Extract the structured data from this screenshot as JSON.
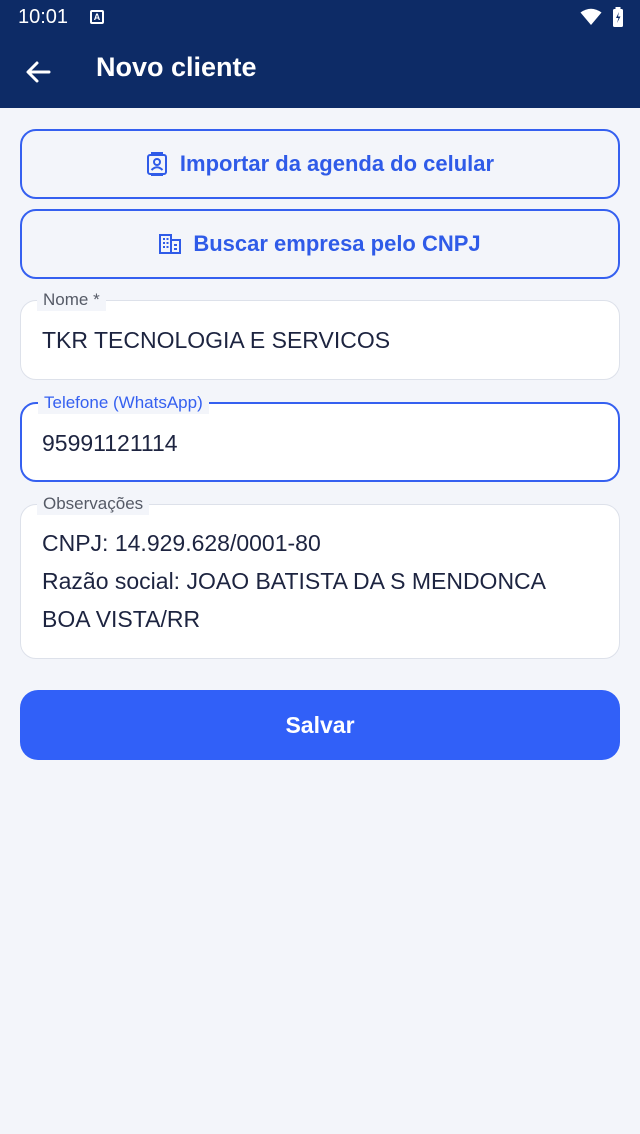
{
  "status_bar": {
    "time": "10:01",
    "notification_glyph": "A"
  },
  "appbar": {
    "title": "Novo cliente",
    "background_color": "#0d2b66"
  },
  "actions": {
    "import_contacts_label": "Importar da agenda do celular",
    "import_contacts_icon": "contact-card-icon",
    "search_cnpj_label": "Buscar empresa pelo CNPJ",
    "search_cnpj_icon": "building-icon"
  },
  "form": {
    "nome": {
      "label": "Nome *",
      "value": "TKR TECNOLOGIA E SERVICOS"
    },
    "telefone": {
      "label": "Telefone (WhatsApp)",
      "value": "95991121114"
    },
    "observacoes": {
      "label": "Observações",
      "lines": [
        "CNPJ: 14.929.628/0001-80",
        "Razão social: JOAO BATISTA DA S MENDONCA",
        "BOA VISTA/RR"
      ]
    }
  },
  "save_button": {
    "label": "Salvar"
  },
  "colors": {
    "accent": "#3160f8",
    "page_background": "#f3f5fa"
  }
}
